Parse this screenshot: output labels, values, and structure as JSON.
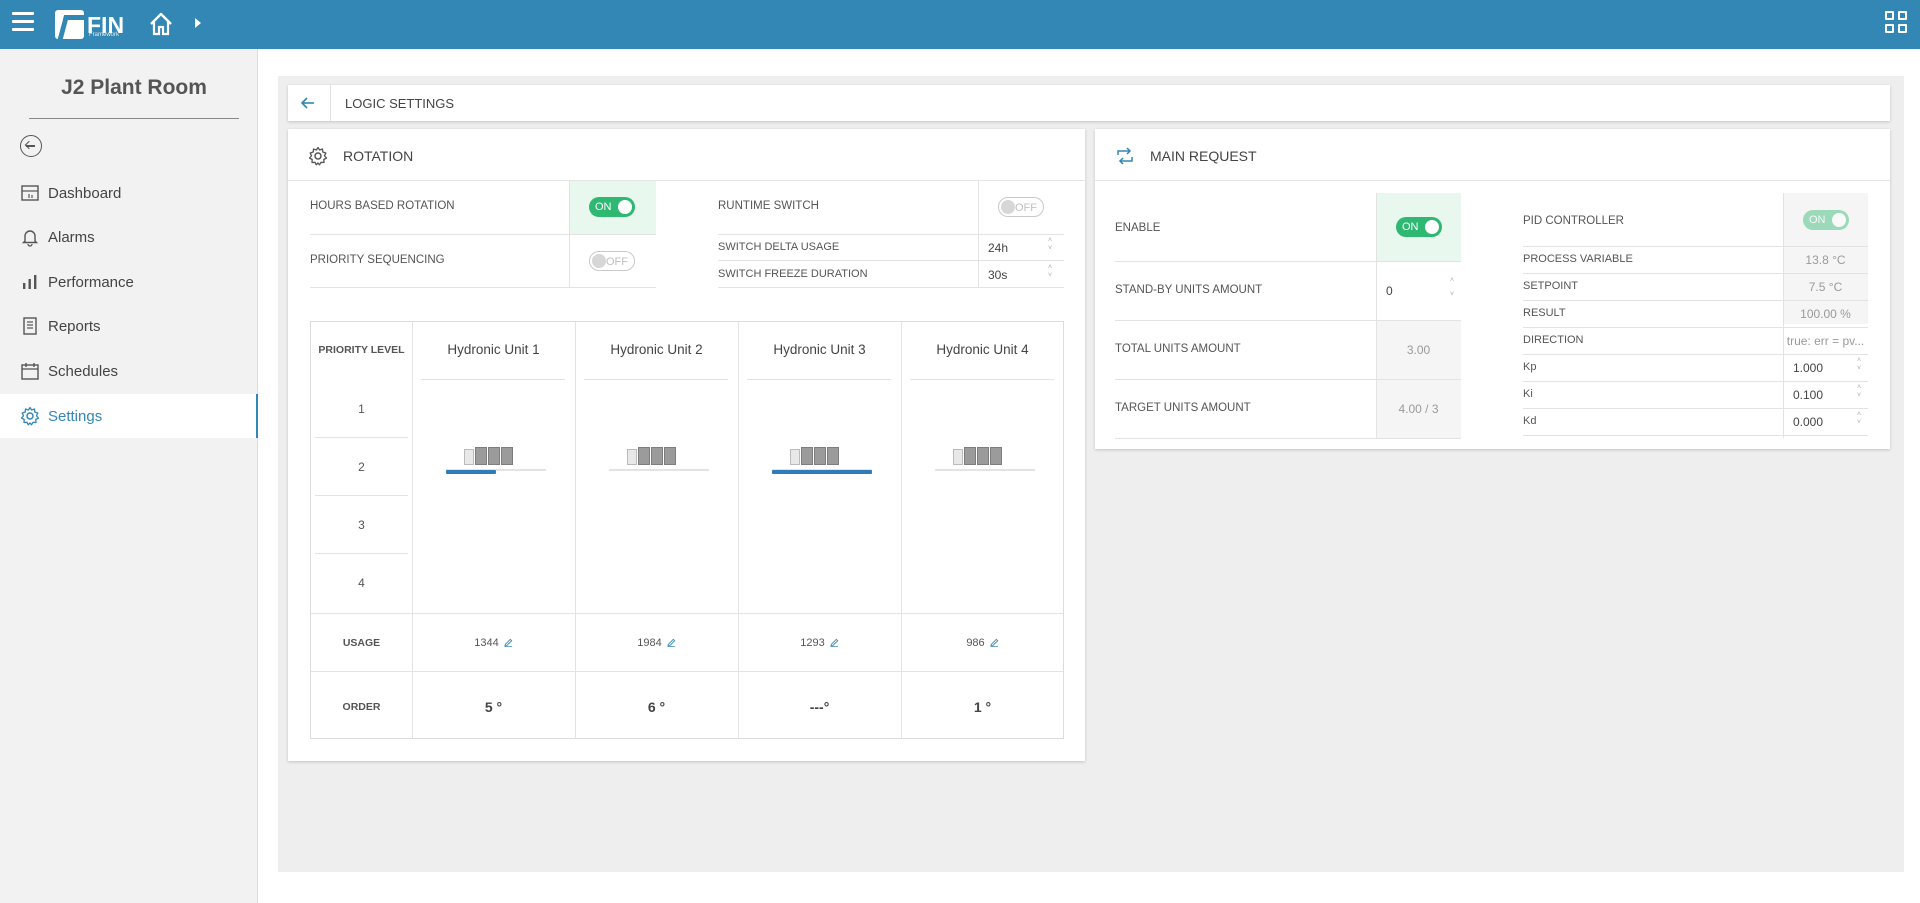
{
  "topbar": {
    "logo_text": "FIN",
    "logo_sub": "Framework",
    "icons": [
      "hamburger-icon",
      "home-icon",
      "chevron-right-icon",
      "apps-grid-icon"
    ]
  },
  "sidebar": {
    "title": "J2 Plant Room",
    "items": [
      {
        "label": "Dashboard",
        "icon": "dashboard-icon"
      },
      {
        "label": "Alarms",
        "icon": "bell-icon"
      },
      {
        "label": "Performance",
        "icon": "bar-chart-icon"
      },
      {
        "label": "Reports",
        "icon": "report-icon"
      },
      {
        "label": "Schedules",
        "icon": "calendar-icon"
      },
      {
        "label": "Settings",
        "icon": "gear-icon",
        "active": true
      }
    ]
  },
  "header": {
    "title": "LOGIC SETTINGS"
  },
  "rotation": {
    "title": "ROTATION",
    "hours_based_rotation": {
      "label": "HOURS BASED ROTATION",
      "state": "ON"
    },
    "priority_sequencing": {
      "label": "PRIORITY SEQUENCING",
      "state": "OFF"
    },
    "runtime_switch": {
      "label": "RUNTIME SWITCH",
      "state": "OFF"
    },
    "switch_delta_usage": {
      "label": "SWITCH DELTA USAGE",
      "value": "24h"
    },
    "switch_freeze_duration": {
      "label": "SWITCH FREEZE DURATION",
      "value": "30s"
    },
    "table": {
      "priority_header": "PRIORITY LEVEL",
      "priority_levels": [
        "1",
        "2",
        "3",
        "4"
      ],
      "usage_label": "USAGE",
      "order_label": "ORDER",
      "units": [
        {
          "name": "Hydronic Unit 1",
          "usage": "1344",
          "order": "5 °",
          "bar_fraction": 0.5
        },
        {
          "name": "Hydronic Unit 2",
          "usage": "1984",
          "order": "6 °",
          "bar_fraction": 0
        },
        {
          "name": "Hydronic Unit 3",
          "usage": "1293",
          "order": "---°",
          "bar_fraction": 1.0
        },
        {
          "name": "Hydronic Unit 4",
          "usage": "986",
          "order": "1 °",
          "bar_fraction": 0
        }
      ]
    }
  },
  "main_request": {
    "title": "MAIN REQUEST",
    "enable": {
      "label": "ENABLE",
      "state": "ON"
    },
    "standby_units": {
      "label": "STAND-BY UNITS AMOUNT",
      "value": "0"
    },
    "total_units": {
      "label": "TOTAL UNITS AMOUNT",
      "value": "3.00"
    },
    "target_units": {
      "label": "TARGET UNITS AMOUNT",
      "value": "4.00 / 3"
    },
    "pid_controller": {
      "label": "PID CONTROLLER",
      "state": "ON"
    },
    "process_variable": {
      "label": "PROCESS VARIABLE",
      "value": "13.8 °C"
    },
    "setpoint": {
      "label": "SETPOINT",
      "value": "7.5 °C"
    },
    "result": {
      "label": "RESULT",
      "value": "100.00 %"
    },
    "direction": {
      "label": "DIRECTION",
      "value": "true: err = pv..."
    },
    "kp": {
      "label": "Kp",
      "value": "1.000"
    },
    "ki": {
      "label": "Ki",
      "value": "0.100"
    },
    "kd": {
      "label": "Kd",
      "value": "0.000"
    }
  },
  "colors": {
    "topbar": "#3287b4",
    "toggle_on": "#2eb872",
    "accent": "#3287b4",
    "usage_bar": "#2f7cb9"
  }
}
